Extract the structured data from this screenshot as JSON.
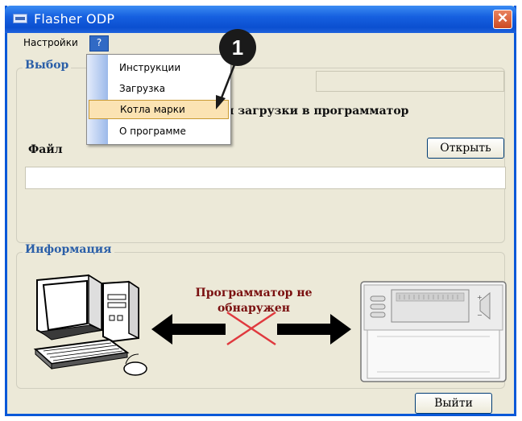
{
  "window": {
    "title": "Flasher ODP",
    "close_glyph": "✕"
  },
  "menubar": {
    "items": [
      {
        "label": "Настройки"
      },
      {
        "label": "?"
      }
    ]
  },
  "dropdown": {
    "items": [
      {
        "label": "Инструкции"
      },
      {
        "label": "Загрузка"
      },
      {
        "label": "Котла марки"
      },
      {
        "label": "О программе"
      }
    ],
    "highlighted_index": 2
  },
  "callout": {
    "number": "1"
  },
  "selection_group": {
    "legend": "Выбор",
    "instruction_text": "я загрузки в программатор",
    "file_label": "Файл",
    "open_button": "Открыть",
    "file_input_value": ""
  },
  "info_group": {
    "legend": "Информация",
    "status_line1": "Программатор не",
    "status_line2": "обнаружен",
    "left_device_icon": "computer-icon",
    "right_device_icon": "thermostat-programmer-icon",
    "arrows": "double-arrow-icon",
    "disconnected_mark": "red-cross-icon"
  },
  "footer": {
    "exit_button": "Выйти"
  },
  "colors": {
    "titlebar": "#0b4fd0",
    "menu_highlight": "#316ac5",
    "group_legend": "#2b5fa8",
    "status_text": "#7a1010",
    "cross": "#e0393e",
    "dropdown_highlight": "#fbe3b3"
  }
}
